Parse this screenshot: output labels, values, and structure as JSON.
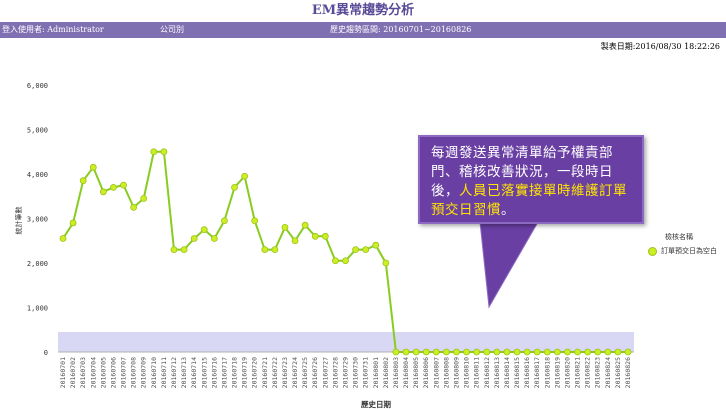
{
  "page": {
    "title": "EM異常趨勢分析",
    "user_label": "登入使用者: Administrator",
    "company_label": "公司別",
    "range_label": "歷史趨勢區間: 20160701~20160826",
    "report_date": "製表日期:2016/08/30 18:22:26"
  },
  "callout": {
    "line1": "每週發送異常清單給予權責部門、稽核改善狀況，一段時日後，",
    "highlight": "人員已落實接單時維護訂單預交日習慣",
    "end": "。"
  },
  "colors": {
    "line": "#88cc22",
    "marker": "#ccee22",
    "band": "#d8d8f4",
    "header": "#7f70b2",
    "callout": "#6a3fa4"
  },
  "chart_data": {
    "type": "line",
    "xlabel": "歷史日期",
    "ylabel": "統計筆數",
    "ylim": [
      0,
      6000
    ],
    "yticks": [
      0,
      1000,
      2000,
      3000,
      4000,
      5000,
      6000
    ],
    "ytick_labels": [
      "0",
      "1,000",
      "2,000",
      "3,000",
      "4,000",
      "5,000",
      "6,000"
    ],
    "legend_title": "檢核名稱",
    "band": [
      0,
      450
    ],
    "categories": [
      "20160701",
      "20160702",
      "20160703",
      "20160704",
      "20160705",
      "20160706",
      "20160707",
      "20160708",
      "20160709",
      "20160710",
      "20160711",
      "20160712",
      "20160713",
      "20160714",
      "20160715",
      "20160716",
      "20160717",
      "20160718",
      "20160719",
      "20160720",
      "20160721",
      "20160722",
      "20160723",
      "20160724",
      "20160725",
      "20160726",
      "20160727",
      "20160728",
      "20160729",
      "20160730",
      "20160731",
      "20160801",
      "20160802",
      "20160803",
      "20160804",
      "20160805",
      "20160806",
      "20160807",
      "20160808",
      "20160809",
      "20160810",
      "20160811",
      "20160812",
      "20160813",
      "20160814",
      "20160815",
      "20160816",
      "20160817",
      "20160818",
      "20160819",
      "20160820",
      "20160821",
      "20160822",
      "20160823",
      "20160824",
      "20160825",
      "20160826"
    ],
    "series": [
      {
        "name": "訂單預交日為空白",
        "values": [
          2550,
          2900,
          3850,
          4150,
          3600,
          3700,
          3750,
          3250,
          3450,
          4500,
          4500,
          2300,
          2300,
          2550,
          2750,
          2550,
          2950,
          3700,
          3950,
          2950,
          2300,
          2300,
          2800,
          2500,
          2850,
          2600,
          2600,
          2050,
          2050,
          2300,
          2300,
          2400,
          2000,
          0,
          0,
          0,
          0,
          0,
          0,
          0,
          0,
          0,
          0,
          0,
          0,
          0,
          0,
          0,
          0,
          0,
          0,
          0,
          0,
          0,
          0,
          0,
          0
        ]
      }
    ]
  }
}
